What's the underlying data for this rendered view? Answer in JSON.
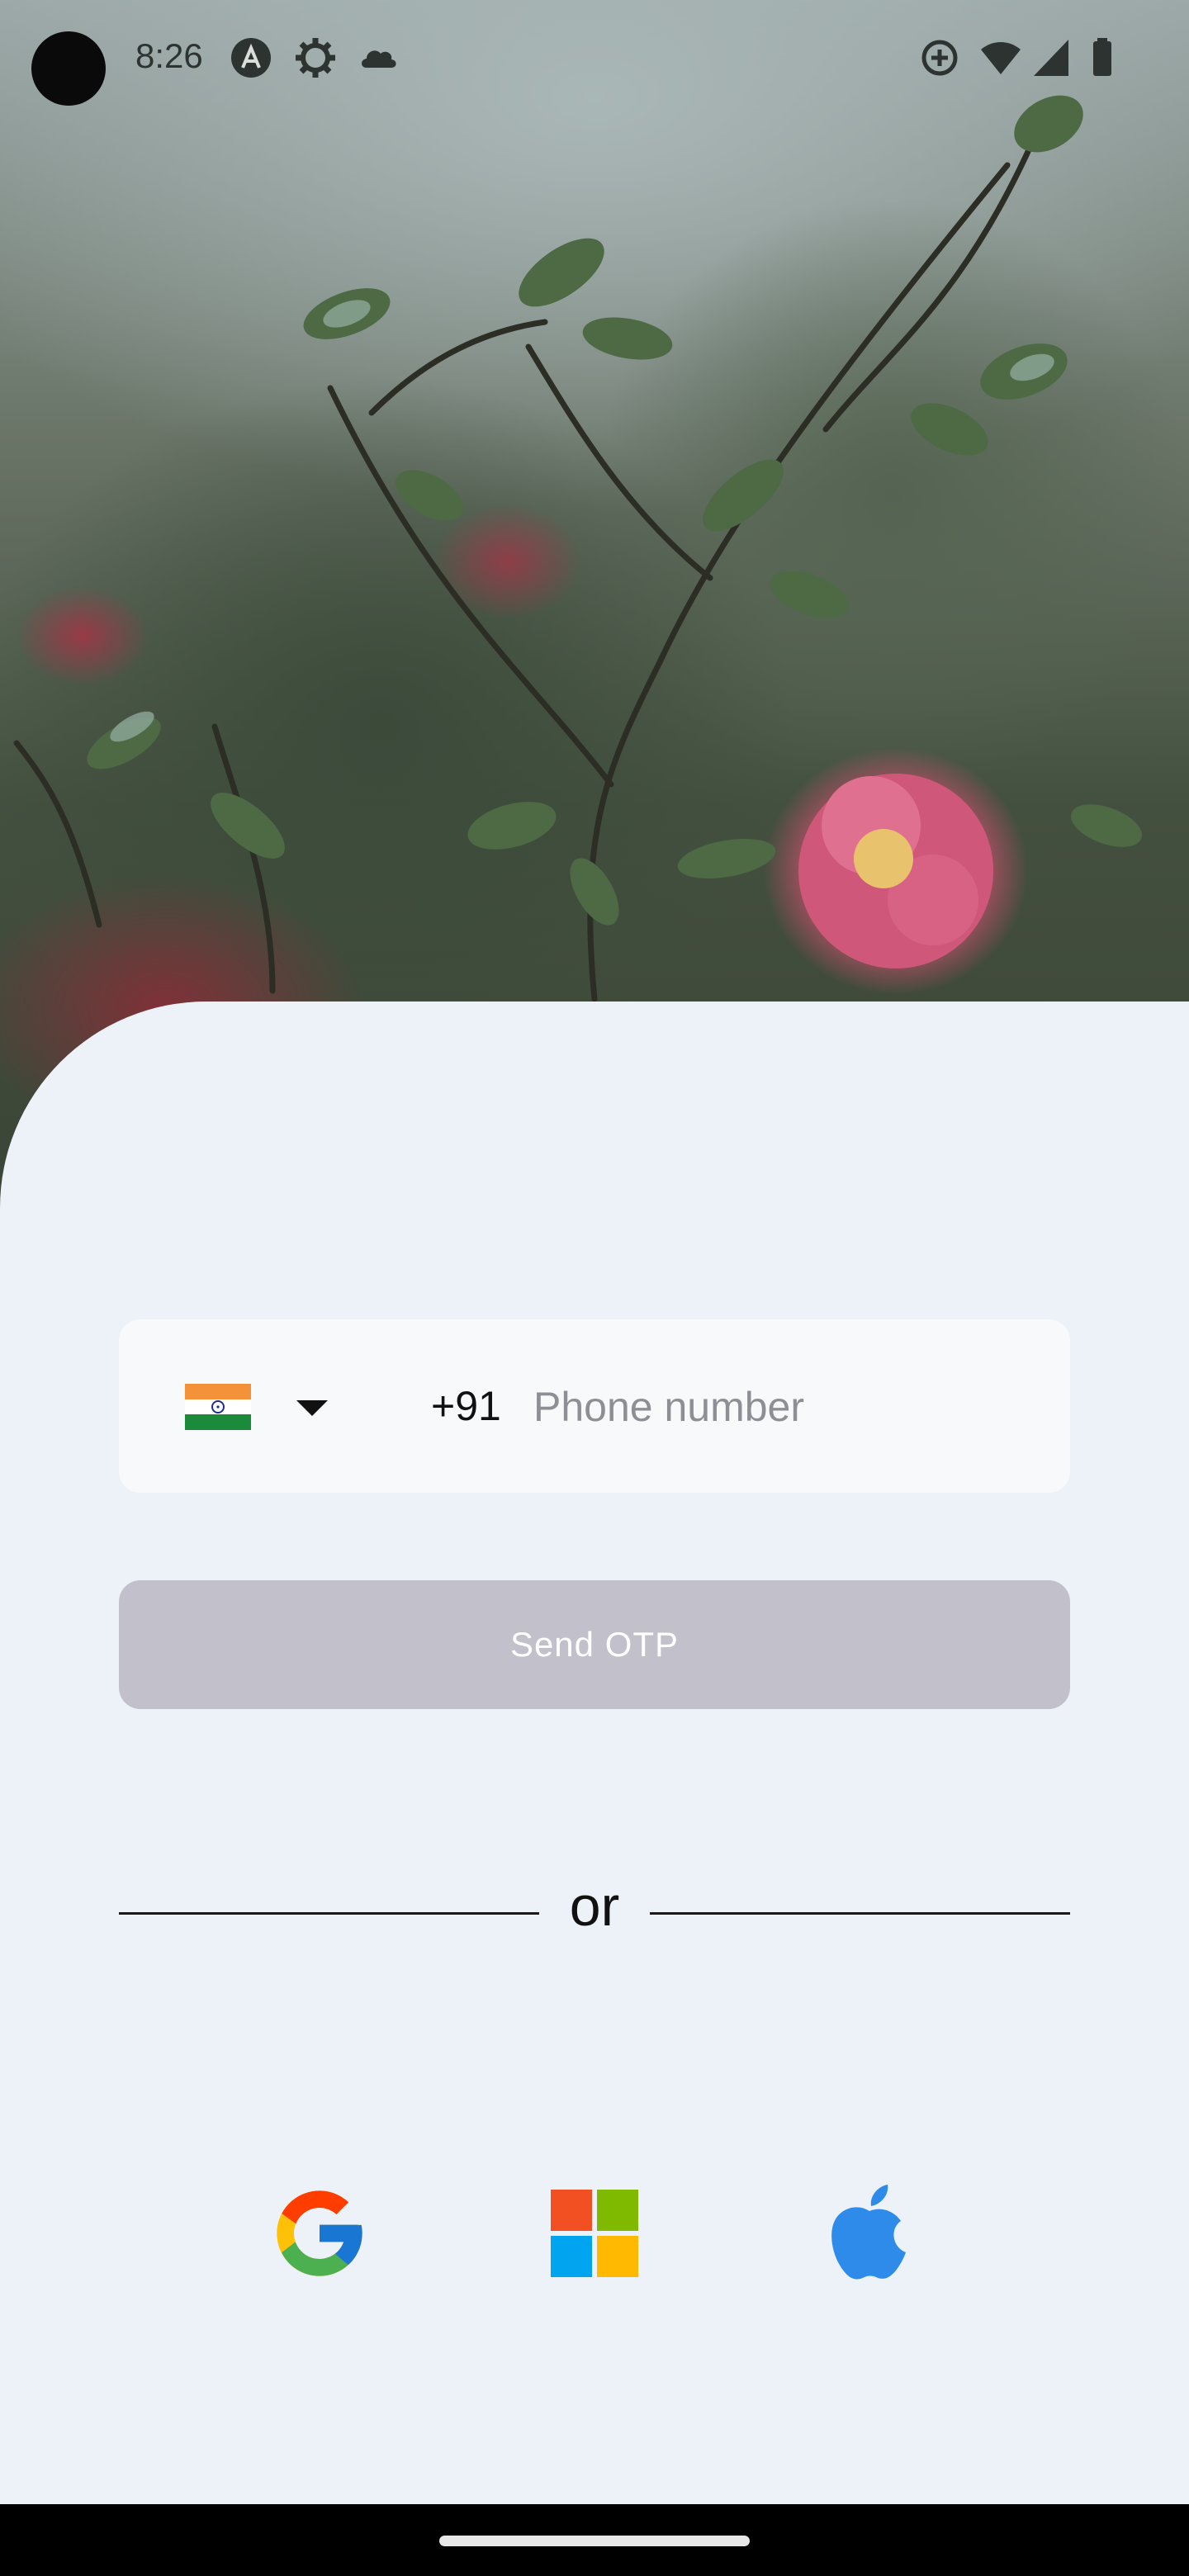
{
  "status_bar": {
    "time": "8:26",
    "left_icons": [
      "app-notification-icon",
      "settings-gear-icon",
      "cloud-icon"
    ],
    "right_icons": [
      "data-saver-icon",
      "wifi-icon",
      "cellular-signal-icon",
      "battery-icon"
    ]
  },
  "hero": {
    "image": "pink-camellia-flower-photo"
  },
  "phone": {
    "country_flag": "india-flag-icon",
    "dial_code": "+91",
    "placeholder": "Phone number",
    "value": ""
  },
  "send_otp": {
    "label": "Send OTP",
    "enabled": false
  },
  "divider": {
    "label": "or"
  },
  "social_logins": [
    {
      "icon": "google-icon"
    },
    {
      "icon": "microsoft-icon"
    },
    {
      "icon": "apple-icon",
      "color": "#2E8BEA"
    }
  ],
  "colors": {
    "background": "#EDF2F8",
    "input_bg": "#F8F9FB",
    "button_disabled": "#C2C0CA",
    "apple_blue": "#2E8BEA"
  }
}
